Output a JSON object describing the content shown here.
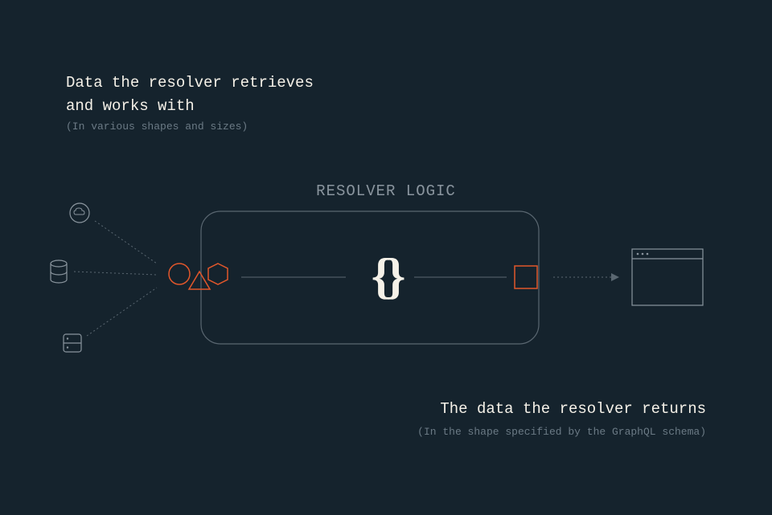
{
  "input": {
    "heading_line1": "Data the resolver retrieves",
    "heading_line2": "and works with",
    "subheading": "(In various shapes and sizes)"
  },
  "center": {
    "label": "RESOLVER LOGIC",
    "braces": "{}"
  },
  "output": {
    "heading": "The data the resolver returns",
    "subheading": "(In the shape specified by the GraphQL schema)"
  },
  "colors": {
    "background": "#15232d",
    "text_primary": "#f5f1e8",
    "text_muted": "#6b7a85",
    "accent": "#e2572b",
    "line": "#5a6771"
  }
}
